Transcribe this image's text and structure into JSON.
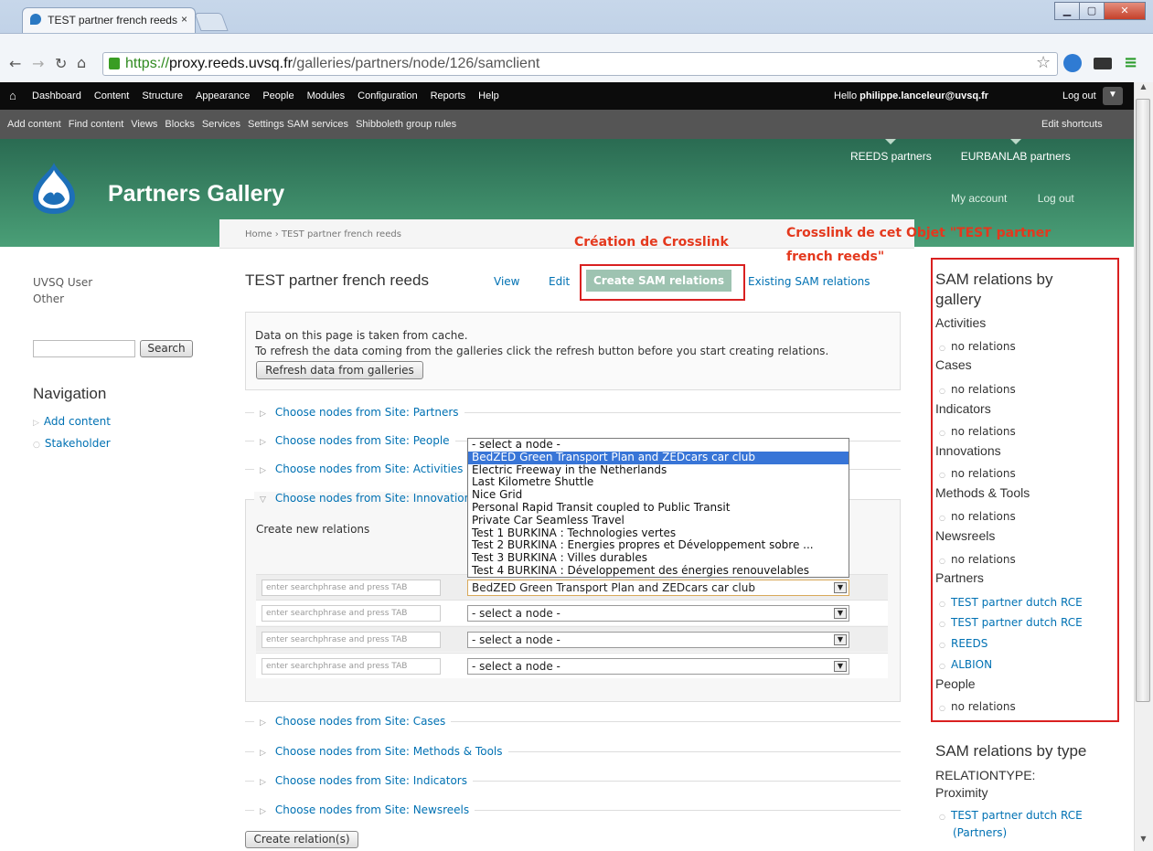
{
  "browser": {
    "tab_title": "TEST partner french reeds",
    "tab_close": "×",
    "url_https": "https://",
    "url_host": "proxy.reeds.uvsq.fr",
    "url_path": "/galleries/partners/node/126/samclient",
    "nav_icons": [
      "back-arrow-icon",
      "forward-arrow-icon",
      "reload-icon",
      "home-icon"
    ]
  },
  "admin_menu": {
    "items": [
      "Dashboard",
      "Content",
      "Structure",
      "Appearance",
      "People",
      "Modules",
      "Configuration",
      "Reports",
      "Help"
    ],
    "hello_prefix": "Hello ",
    "hello_user": "philippe.lanceleur@uvsq.fr",
    "logout": "Log out"
  },
  "shortcuts": {
    "items": [
      "Add content",
      "Find content",
      "Views",
      "Blocks",
      "Services",
      "Settings SAM services",
      "Shibboleth group rules"
    ],
    "edit": "Edit shortcuts"
  },
  "site": {
    "name": "Partners Gallery",
    "secondary_nav": [
      "REEDS partners",
      "EURBANLAB partners"
    ],
    "user_nav": [
      "My account",
      "Log out"
    ]
  },
  "breadcrumb": "Home › TEST partner french reeds",
  "sidebar_left": {
    "user_name": "UVSQ User",
    "user_other": "Other",
    "search_button": "Search",
    "nav_title": "Navigation",
    "nav_links": [
      "Add content",
      "Stakeholder"
    ]
  },
  "node": {
    "title": "TEST partner french reeds",
    "tabs": [
      "View",
      "Edit",
      "Create SAM relations",
      "Existing SAM relations"
    ]
  },
  "annotations": {
    "crosslink_creation": "Création de Crosslink",
    "crosslink_object_1": "Crosslink de cet Objet \"TEST partner",
    "crosslink_object_2": "french reeds\""
  },
  "cache_notice": {
    "line1": "Data on this page is taken from cache.",
    "line2": "To refresh the data coming from the galleries click the refresh button before you start creating relations.",
    "button": "Refresh data from galleries"
  },
  "fieldsets": {
    "partners": "Choose nodes from Site: Partners",
    "people": "Choose nodes from Site: People",
    "activities": "Choose nodes from Site: Activities",
    "innovations": "Choose nodes from Site: Innovations",
    "cases": "Choose nodes from Site: Cases",
    "methods": "Choose nodes from Site: Methods & Tools",
    "indicators": "Choose nodes from Site: Indicators",
    "newsreels": "Choose nodes from Site: Newsreels"
  },
  "create_new_relations": "Create new relations",
  "search_placeholder": "enter searchphrase and press TAB",
  "relation_rows": [
    "BedZED Green Transport Plan and ZEDcars car club",
    "- select a node -",
    "- select a node -",
    "- select a node -"
  ],
  "dropdown_options": [
    "- select a node -",
    "BedZED Green Transport Plan and ZEDcars car club",
    "Electric Freeway in the Netherlands",
    "Last Kilometre Shuttle",
    "Nice Grid",
    "Personal Rapid Transit coupled to Public Transit",
    "Private Car Seamless Travel",
    "Test 1 BURKINA : Technologies vertes",
    "Test 2 BURKINA : Energies propres et Développement sobre ...",
    "Test 3 BURKINA : Villes durables",
    "Test 4 BURKINA : Développement des énergies renouvelables"
  ],
  "create_button": "Create relation(s)",
  "sam_by_gallery": {
    "title_1": "SAM relations by",
    "title_2": "gallery",
    "activities": "Activities",
    "activities_item": "no relations",
    "cases": "Cases",
    "cases_item": "no relations",
    "indicators": "Indicators",
    "indicators_item": "no relations",
    "innovations": "Innovations",
    "innovations_item": "no relations",
    "methods": "Methods & Tools",
    "methods_item": "no relations",
    "newsreels": "Newsreels",
    "newsreels_item": "no relations",
    "partners": "Partners",
    "partners_items": [
      "TEST partner dutch RCE",
      "TEST partner dutch RCE",
      "REEDS",
      "ALBION"
    ],
    "people": "People",
    "people_item": "no relations"
  },
  "sam_by_type": {
    "title": "SAM relations by type",
    "type_1": "RELATIONTYPE:",
    "type_2": "Proximity",
    "item_1": "TEST partner dutch RCE",
    "item_2": "(Partners)"
  },
  "colors": {
    "admin_bar": "#0c0c0c",
    "shortcut_bar": "#555555",
    "header_green": "#3b8a65",
    "link_blue": "#0071b3",
    "annotation_red": "#e4381d",
    "dropdown_selected": "#3875d7"
  }
}
